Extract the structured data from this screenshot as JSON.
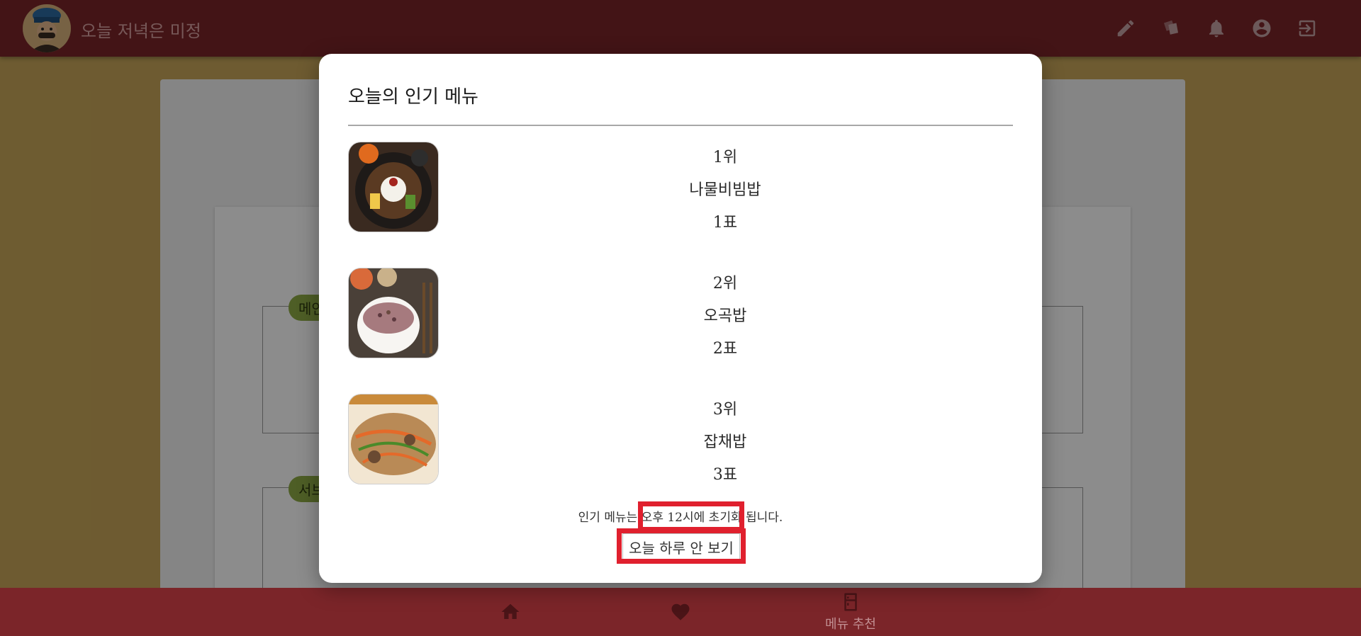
{
  "app": {
    "title": "오늘 저녁은 미정"
  },
  "top_icons": [
    "pencil-icon",
    "cards-icon",
    "bell-icon",
    "account-icon",
    "logout-icon"
  ],
  "background": {
    "sections": [
      {
        "tag": "메인"
      },
      {
        "tag": "서브"
      }
    ]
  },
  "modal": {
    "title": "오늘의 인기 메뉴",
    "ranks": [
      {
        "rank": "1위",
        "name": "나물비빔밥",
        "votes": "1표"
      },
      {
        "rank": "2위",
        "name": "오곡밥",
        "votes": "2표"
      },
      {
        "rank": "3위",
        "name": "잡채밥",
        "votes": "3표"
      }
    ],
    "notice": "인기 메뉴는 오후 12시에 초기화 됩니다.",
    "hide_today_button": "오늘 하루 안 보기"
  },
  "bottom_nav": {
    "items": [
      {
        "icon": "home-icon",
        "label": ""
      },
      {
        "icon": "heart-icon",
        "label": ""
      },
      {
        "icon": "fridge-icon",
        "label": "메뉴 추천"
      }
    ]
  },
  "colors": {
    "primary": "#7b2529",
    "background": "#c8a75a",
    "tag": "#8fab45",
    "highlight": "#e0202e"
  }
}
